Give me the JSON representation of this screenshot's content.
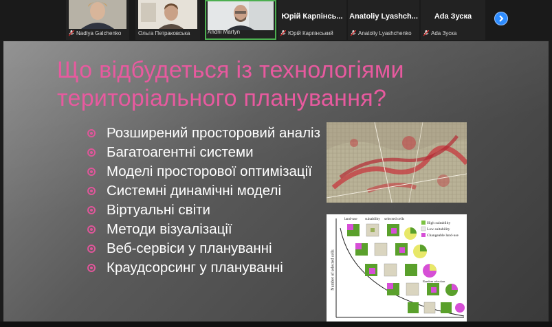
{
  "participants": [
    {
      "name": "Nadiya Galchenko",
      "video": true
    },
    {
      "name": "Ольга Петраковська",
      "video": true
    },
    {
      "name": "Andrii Martyn",
      "video": true
    },
    {
      "name": "Юрій Карпінський",
      "display": "Юрій Карпінсь...",
      "video": false
    },
    {
      "name": "Anatoliy Lyashchenko",
      "display": "Anatoliy Lyashch...",
      "video": false
    },
    {
      "name": "Ada Зуска",
      "display": "Ada Зуска",
      "video": false
    }
  ],
  "slide": {
    "title_line1": "Що відбудеться із технологіями",
    "title_line2": "територіального планування?",
    "bullets": [
      "Розширений просторовий аналіз",
      "Багатоагентні системи",
      "Моделі просторової оптимізації",
      "Системні динамічні моделі",
      "Віртуальні світи",
      "Методи візуалізації",
      "Веб-сервіси у плануванні",
      "Краудсорсинг у плануванні"
    ],
    "figure": {
      "col_landuse": "land-use",
      "col_suitability": "suitability",
      "col_selected": "selected cells",
      "y_axis": "Number of selected cells",
      "legend_high": "High suitability",
      "legend_low": "Low suitability",
      "legend_change": "Changeable land-use",
      "note": "Random selection"
    }
  },
  "colors": {
    "title": "#e85a9f",
    "bullet": "#e0569a",
    "accent": "#2d8cff"
  }
}
